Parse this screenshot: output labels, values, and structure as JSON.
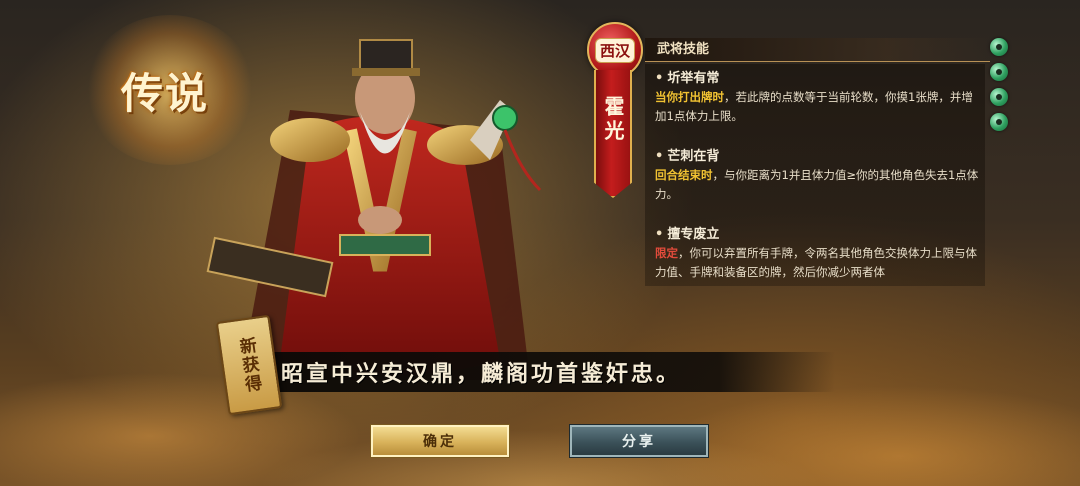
{
  "legend_badge": "传说",
  "dynasty": "西汉",
  "general_name": "霍光",
  "skills_header": "武将技能",
  "skills": [
    {
      "name": "圻举有常",
      "desc_parts": [
        {
          "text": "当你打出牌时",
          "style": "kw"
        },
        {
          "text": "，若此牌的点数等于当前轮数，你摸1张牌，并增加1点体力上限。",
          "style": ""
        }
      ]
    },
    {
      "name": "芒刺在背",
      "desc_parts": [
        {
          "text": "回合结束时",
          "style": "kw"
        },
        {
          "text": "，与你距离为1并且体力值≥你的其他角色失去1点体力。",
          "style": ""
        }
      ]
    },
    {
      "name": "擅专废立",
      "desc_parts": [
        {
          "text": "限定",
          "style": "kw-red"
        },
        {
          "text": "，你可以弃置所有手牌，令两名其他角色交换体力上限与体力值、手牌和装备区的牌，然后你减少两者体",
          "style": ""
        }
      ]
    }
  ],
  "jade_icon_count": 4,
  "new_tag": "新获得",
  "quote": "昭宣中兴安汉鼎，麟阁功首鉴奸忠。",
  "buttons": {
    "confirm": "确定",
    "share": "分享"
  },
  "colors": {
    "keyword": "#f1c232",
    "keyword_limit": "#e24b3b",
    "banner_red": "#c41d1d",
    "gold_trim": "#e0b04e"
  }
}
